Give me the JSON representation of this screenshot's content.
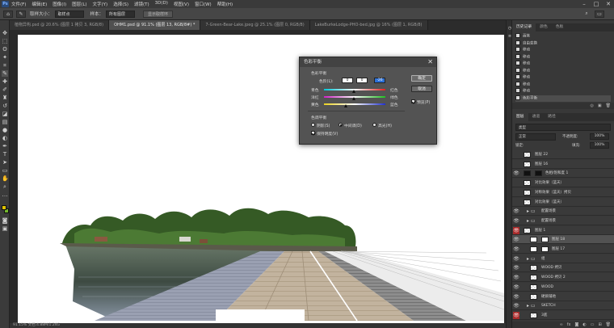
{
  "menubar": {
    "items": [
      "文件(F)",
      "编辑(E)",
      "图像(I)",
      "图层(L)",
      "文字(Y)",
      "选择(S)",
      "滤镜(T)",
      "3D(D)",
      "视图(V)",
      "窗口(W)",
      "帮助(H)"
    ]
  },
  "optbar": {
    "sample_label": "取样大小：",
    "sample_value": "取样点",
    "sample_layer_label": "样本：",
    "sample_layer_value": "所有图层",
    "ring_button": "显示取样环"
  },
  "tabs": [
    "植物异构.psd @ 20.6% (图层 1 拷贝 3, RGB/8)",
    "OHM1.psd @ 91.1% (图层 13, RGB/8#) *",
    "7-Green-Bear-Lake.jpeg @ 25.1% (图层 0, RGB/8)",
    "LakeBurkeLodge-PHO-bed.jpg @ 16% (图层 1, RGB/8)"
  ],
  "status_text": "91.15%  文档:4.88M/1.24G",
  "dialog": {
    "title": "色彩平衡",
    "group_label": "色彩平衡",
    "levels_label": "色阶(L):",
    "levels": [
      "0",
      "0",
      "-26"
    ],
    "sliders": [
      {
        "left": "青色",
        "right": "红色",
        "value": 0
      },
      {
        "left": "洋红",
        "right": "绿色",
        "value": 0
      },
      {
        "left": "黄色",
        "right": "蓝色",
        "value": -26
      }
    ],
    "tone_group": "色调平衡",
    "tones": [
      "阴影(S)",
      "中间调(D)",
      "高光(H)"
    ],
    "tone_selected": 1,
    "preserve_label": "保持明度(V)",
    "ok": "确定",
    "cancel": "取消",
    "preview": "预览(P)"
  },
  "history": {
    "tabs": [
      "历史记录",
      "颜色",
      "色板"
    ],
    "items": [
      "画笔",
      "自由变换",
      "移动",
      "移动",
      "移动",
      "移动",
      "移动",
      "移动",
      "移动",
      "色彩平衡"
    ]
  },
  "layers": {
    "tabs": [
      "图层",
      "通道",
      "路径"
    ],
    "kind_label": "类型",
    "blend_mode": "正常",
    "opacity_label": "不透明度:",
    "opacity": "100%",
    "lock_label": "锁定:",
    "fill_label": "填充:",
    "fill": "100%",
    "items": [
      {
        "name": "图层 22",
        "thumb": "check",
        "eye": false
      },
      {
        "name": "图层 16",
        "thumb": "check",
        "eye": false
      },
      {
        "name": "色相/饱和度 1",
        "thumb": "black",
        "eye": true
      },
      {
        "name": "对比效果（蓝天）",
        "thumb": "check",
        "eye": false
      },
      {
        "name": "对称效果（蓝天）拷贝",
        "thumb": "check",
        "eye": false
      },
      {
        "name": "对比效果（蓝天）",
        "thumb": "check",
        "eye": false
      },
      {
        "name": "配置场景",
        "thumb": "folder",
        "eye": true
      },
      {
        "name": "配置场景",
        "thumb": "folder",
        "eye": true
      },
      {
        "name": "图层 1",
        "thumb": "check",
        "eye": true,
        "red": true
      },
      {
        "name": "图层 18",
        "thumb": "mask",
        "eye": true
      },
      {
        "name": "图层 17",
        "thumb": "mask",
        "eye": true
      },
      {
        "name": "组",
        "thumb": "folder",
        "eye": true
      },
      {
        "name": "WOOD 拷贝",
        "thumb": "check",
        "eye": true
      },
      {
        "name": "WOOD 拷贝 2",
        "thumb": "check",
        "eye": true
      },
      {
        "name": "WOOD",
        "thumb": "check",
        "eye": true
      },
      {
        "name": "硬质铺地",
        "thumb": "check",
        "eye": true
      },
      {
        "name": "SKETCH",
        "thumb": "folder",
        "eye": true
      },
      {
        "name": "3底",
        "thumb": "check",
        "eye": true,
        "red": true
      }
    ]
  }
}
